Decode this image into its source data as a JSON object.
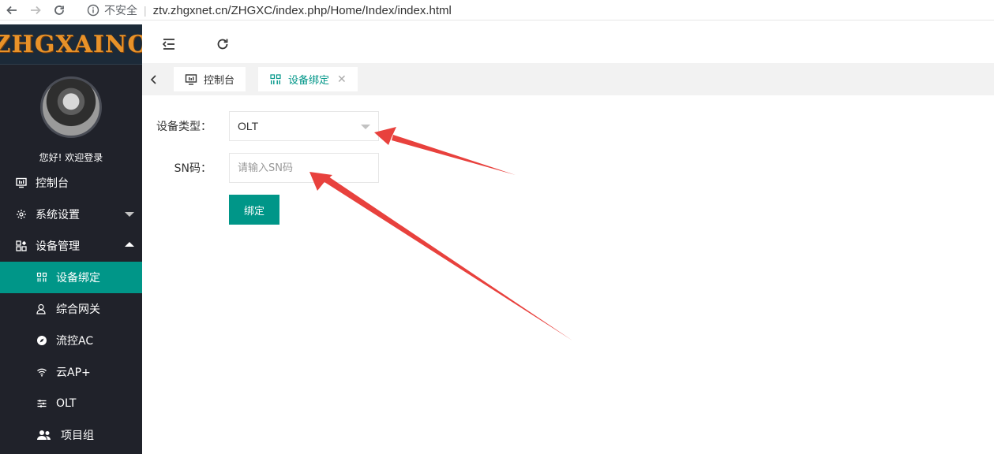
{
  "browser": {
    "insecure_label": "不安全",
    "url": "ztv.zhgxnet.cn/ZHGXC/index.php/Home/Index/index.html"
  },
  "sidebar": {
    "logo": "ZHGXAINO",
    "logo_mark": "®",
    "greeting": "您好! 欢迎登录",
    "items": [
      {
        "label": "控制台",
        "icon": "monitor-icon"
      },
      {
        "label": "系统设置",
        "icon": "gear-icon"
      },
      {
        "label": "设备管理",
        "icon": "apps-icon"
      }
    ],
    "subitems": [
      {
        "label": "设备绑定",
        "icon": "grid-icon",
        "active": true
      },
      {
        "label": "综合网关",
        "icon": "user-icon"
      },
      {
        "label": "流控AC",
        "icon": "compass-icon"
      },
      {
        "label": "云AP+",
        "icon": "wifi-icon"
      },
      {
        "label": "OLT",
        "icon": "sliders-icon"
      },
      {
        "label": "项目组",
        "icon": "group-icon"
      }
    ]
  },
  "tabs": [
    {
      "label": "控制台",
      "icon": "monitor-icon"
    },
    {
      "label": "设备绑定",
      "icon": "grid-icon",
      "active": true
    }
  ],
  "form": {
    "device_type_label": "设备类型：",
    "device_type_value": "OLT",
    "sn_label": "SN码：",
    "sn_placeholder": "请输入SN码",
    "submit_label": "绑定"
  },
  "colors": {
    "accent": "#009688",
    "sidebar_bg": "#20222a",
    "annotation_arrow": "#e8413d"
  }
}
